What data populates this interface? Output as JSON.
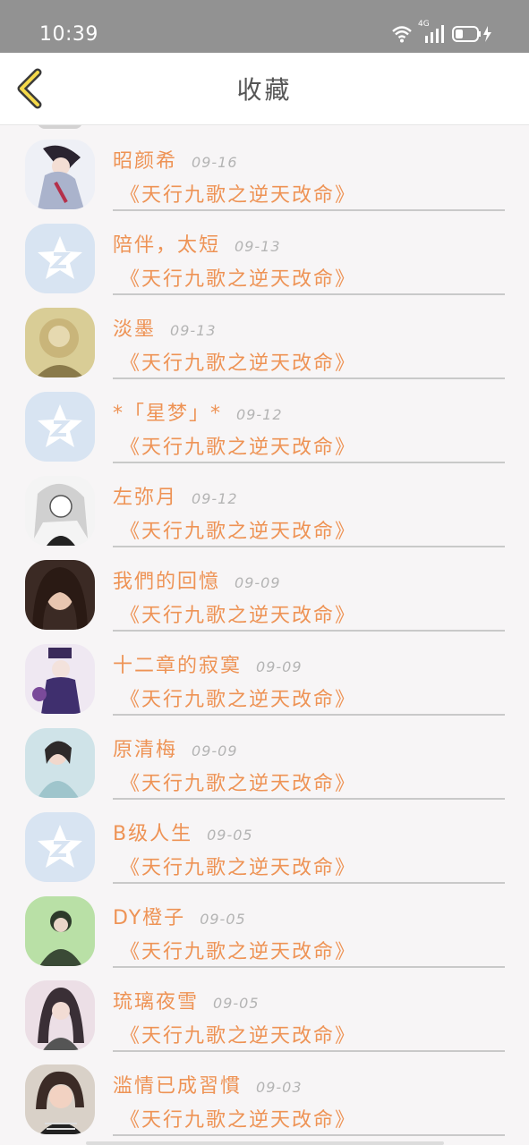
{
  "status": {
    "time": "10:39",
    "network": "4G"
  },
  "header": {
    "title": "收藏"
  },
  "items": [
    {
      "name": "昭颜希",
      "date": "09-16",
      "work": "《天行九歌之逆天改命》",
      "avatar": "anime-avatar"
    },
    {
      "name": "陪伴，太短",
      "date": "09-13",
      "work": "《天行九歌之逆天改命》",
      "avatar": "default-avatar"
    },
    {
      "name": "淡墨",
      "date": "09-13",
      "work": "《天行九歌之逆天改命》",
      "avatar": "portrait-avatar"
    },
    {
      "name": "*「星梦」*",
      "date": "09-12",
      "work": "《天行九歌之逆天改命》",
      "avatar": "default-avatar"
    },
    {
      "name": "左弥月",
      "date": "09-12",
      "work": "《天行九歌之逆天改命》",
      "avatar": "sketch-avatar"
    },
    {
      "name": "我們的回憶",
      "date": "09-09",
      "work": "《天行九歌之逆天改命》",
      "avatar": "photo-avatar"
    },
    {
      "name": "十二章的寂寞",
      "date": "09-09",
      "work": "《天行九歌之逆天改命》",
      "avatar": "anime-avatar"
    },
    {
      "name": "原清梅",
      "date": "09-09",
      "work": "《天行九歌之逆天改命》",
      "avatar": "photo-avatar"
    },
    {
      "name": "B级人生",
      "date": "09-05",
      "work": "《天行九歌之逆天改命》",
      "avatar": "default-avatar"
    },
    {
      "name": "DY橙子",
      "date": "09-05",
      "work": "《天行九歌之逆天改命》",
      "avatar": "anime-avatar"
    },
    {
      "name": "琉璃夜雪",
      "date": "09-05",
      "work": "《天行九歌之逆天改命》",
      "avatar": "anime-avatar"
    },
    {
      "name": "滥情已成習慣",
      "date": "09-03",
      "work": "《天行九歌之逆天改命》",
      "avatar": "photo-avatar"
    }
  ]
}
